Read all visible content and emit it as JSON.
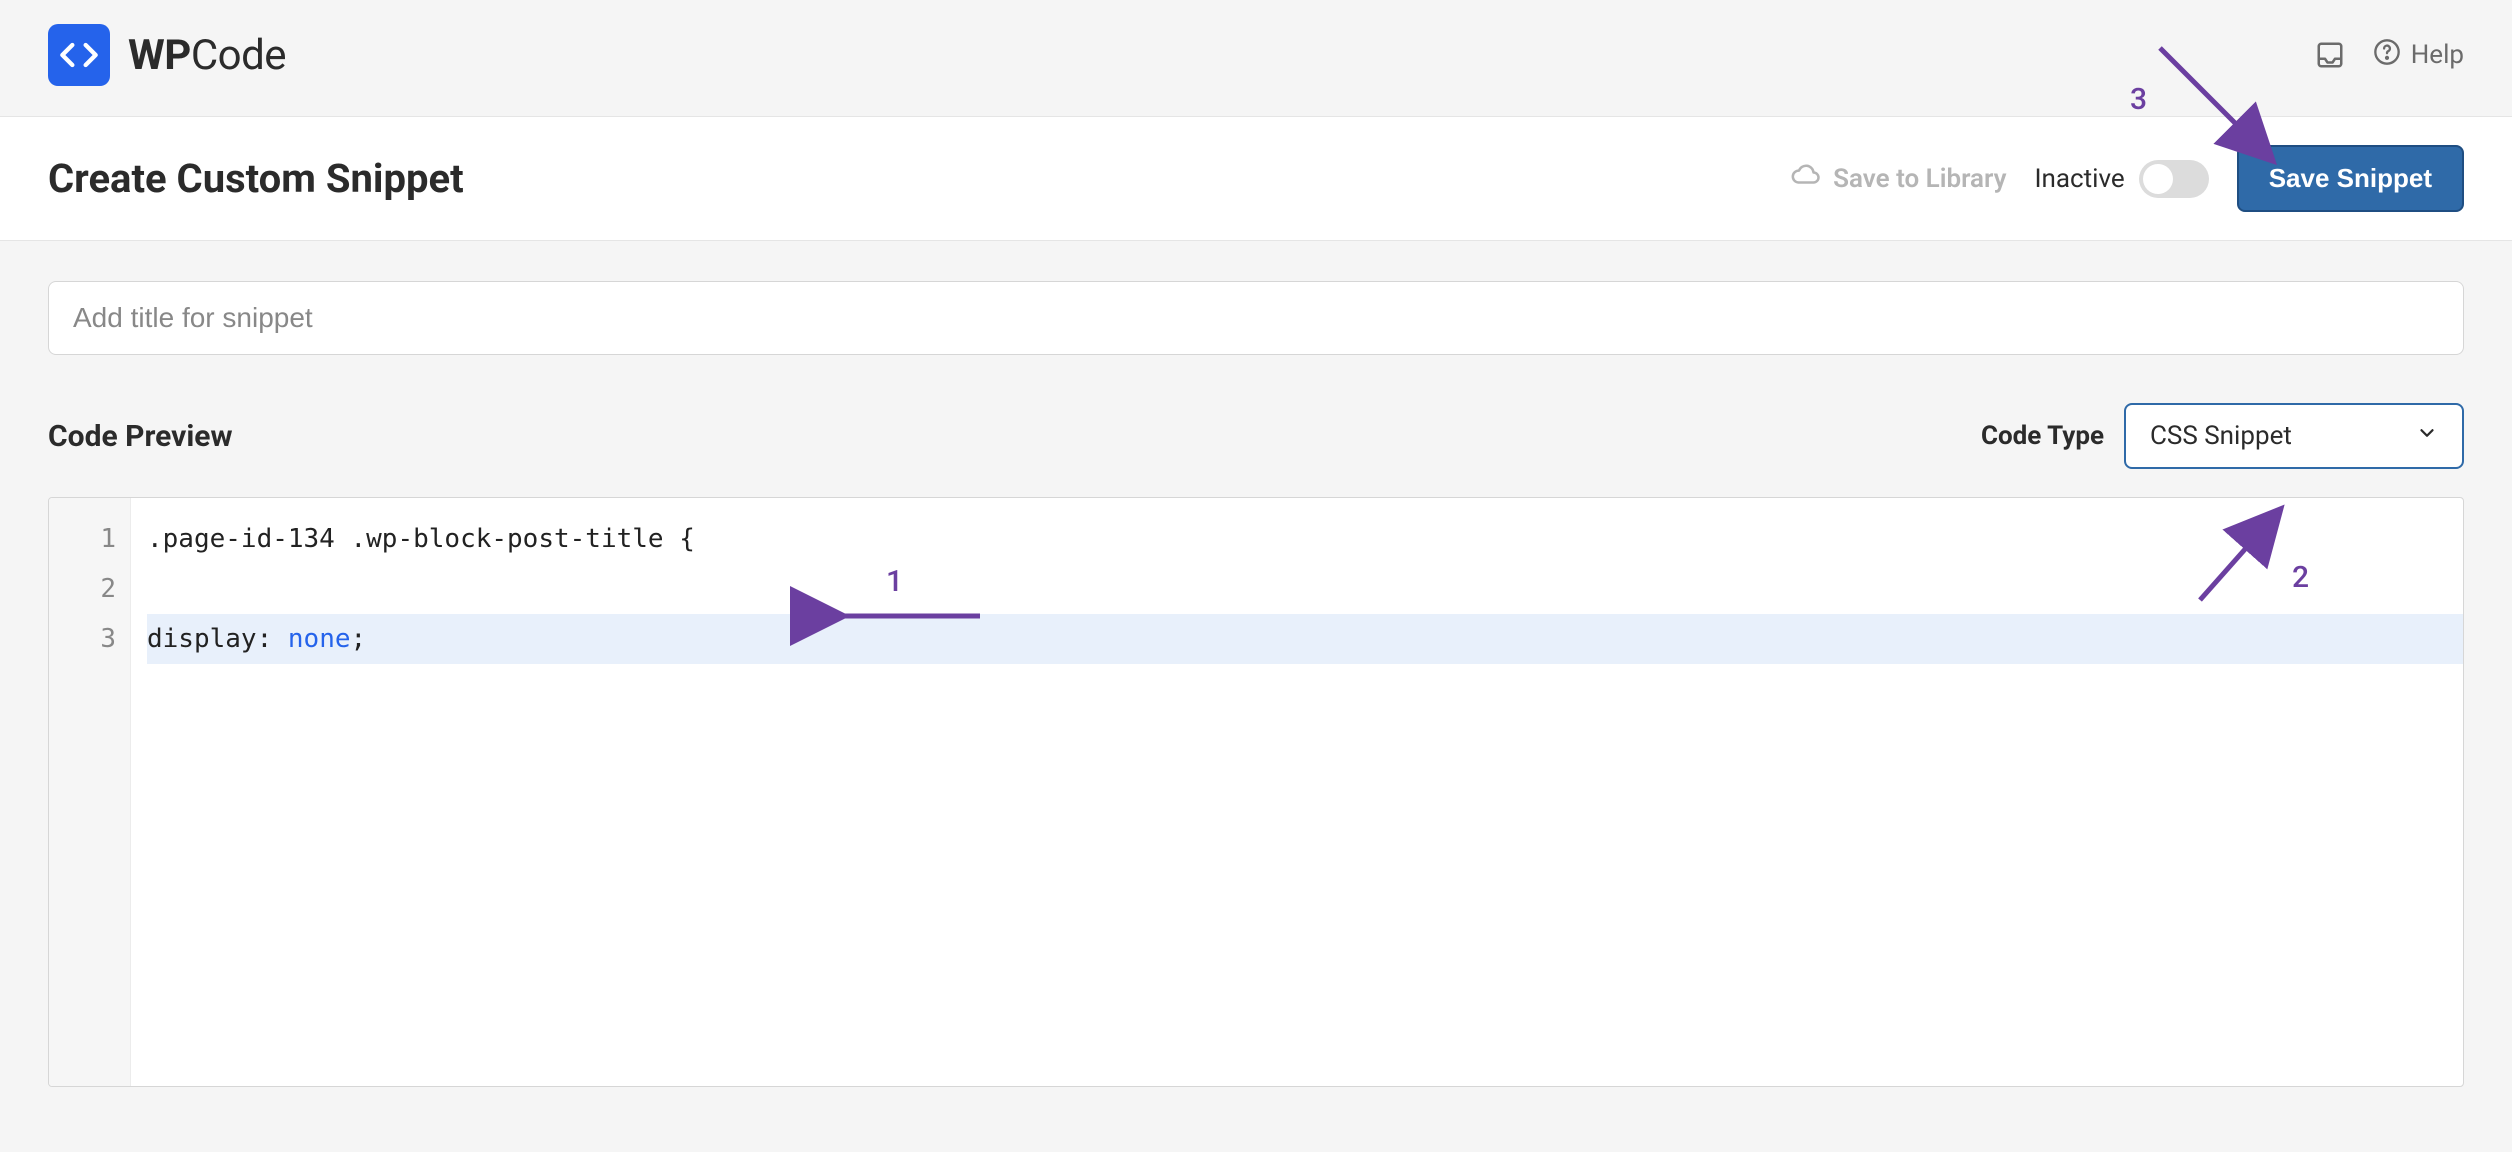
{
  "brand": {
    "bold": "WP",
    "light": "Code"
  },
  "topbar": {
    "help_label": "Help"
  },
  "actionbar": {
    "title": "Create Custom Snippet",
    "save_library_label": "Save to Library",
    "status_label": "Inactive",
    "save_button_label": "Save Snippet"
  },
  "snippet": {
    "title_placeholder": "Add title for snippet"
  },
  "preview": {
    "label": "Code Preview",
    "code_type_label": "Code Type",
    "code_type_value": "CSS Snippet"
  },
  "code": {
    "lines": [
      {
        "n": 1,
        "text": ".page-id-134 .wp-block-post-title {",
        "hl": false
      },
      {
        "n": 2,
        "text": "",
        "hl": false
      },
      {
        "n": 3,
        "text": "display: none;",
        "hl": true,
        "prop": "display",
        "val": "none"
      }
    ]
  },
  "annotations": {
    "one": "1",
    "two": "2",
    "three": "3"
  },
  "colors": {
    "accent_blue": "#2563eb",
    "button_blue": "#2f6aa8",
    "anno_purple": "#6b3fa0"
  }
}
